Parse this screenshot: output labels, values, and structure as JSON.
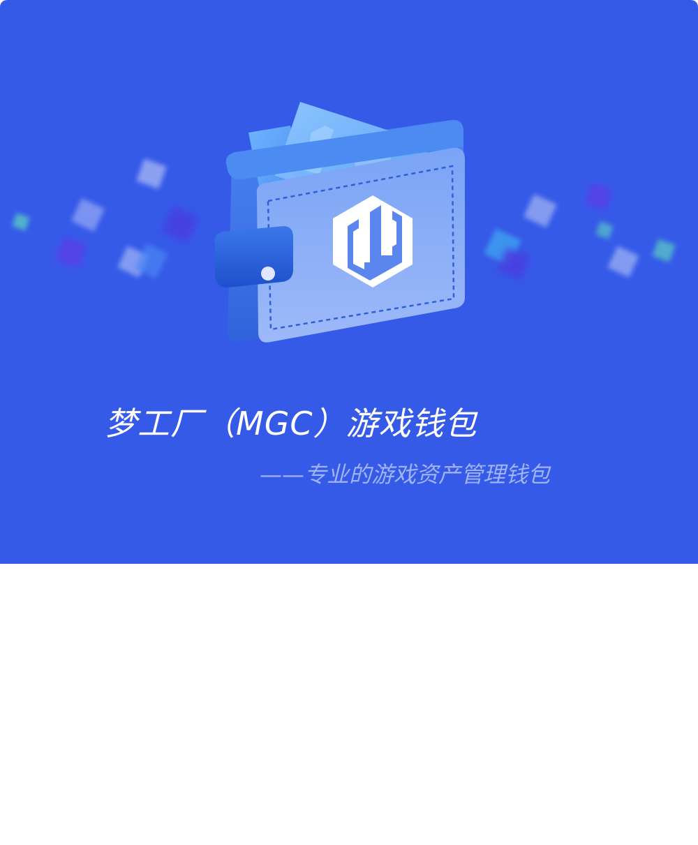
{
  "hero": {
    "title": "梦工厂（MGC）游戏钱包",
    "subtitle": "——专业的游戏资产管理钱包",
    "background_color": "#355ae8",
    "subtitle_color": "#9fb3f5",
    "illustration_icon": "wallet-icon",
    "logo_icon": "mgc-logo-icon"
  }
}
